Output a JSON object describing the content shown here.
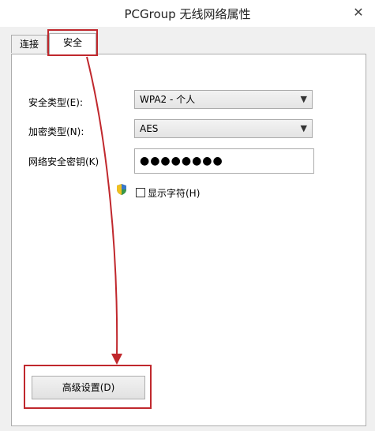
{
  "window": {
    "title": "PCGroup 无线网络属性",
    "close_glyph": "✕"
  },
  "tabs": [
    {
      "label": "连接",
      "active": false
    },
    {
      "label": "安全",
      "active": true
    }
  ],
  "security": {
    "type_label": "安全类型(E):",
    "type_value": "WPA2 - 个人",
    "encryption_label": "加密类型(N):",
    "encryption_value": "AES",
    "key_label": "网络安全密钥(K)",
    "key_value": "●●●●●●●●",
    "show_chars_label": "显示字符(H)",
    "show_chars_checked": false
  },
  "advanced_button": {
    "label": "高级设置(D)"
  },
  "colors": {
    "annotation": "#c0282d"
  }
}
